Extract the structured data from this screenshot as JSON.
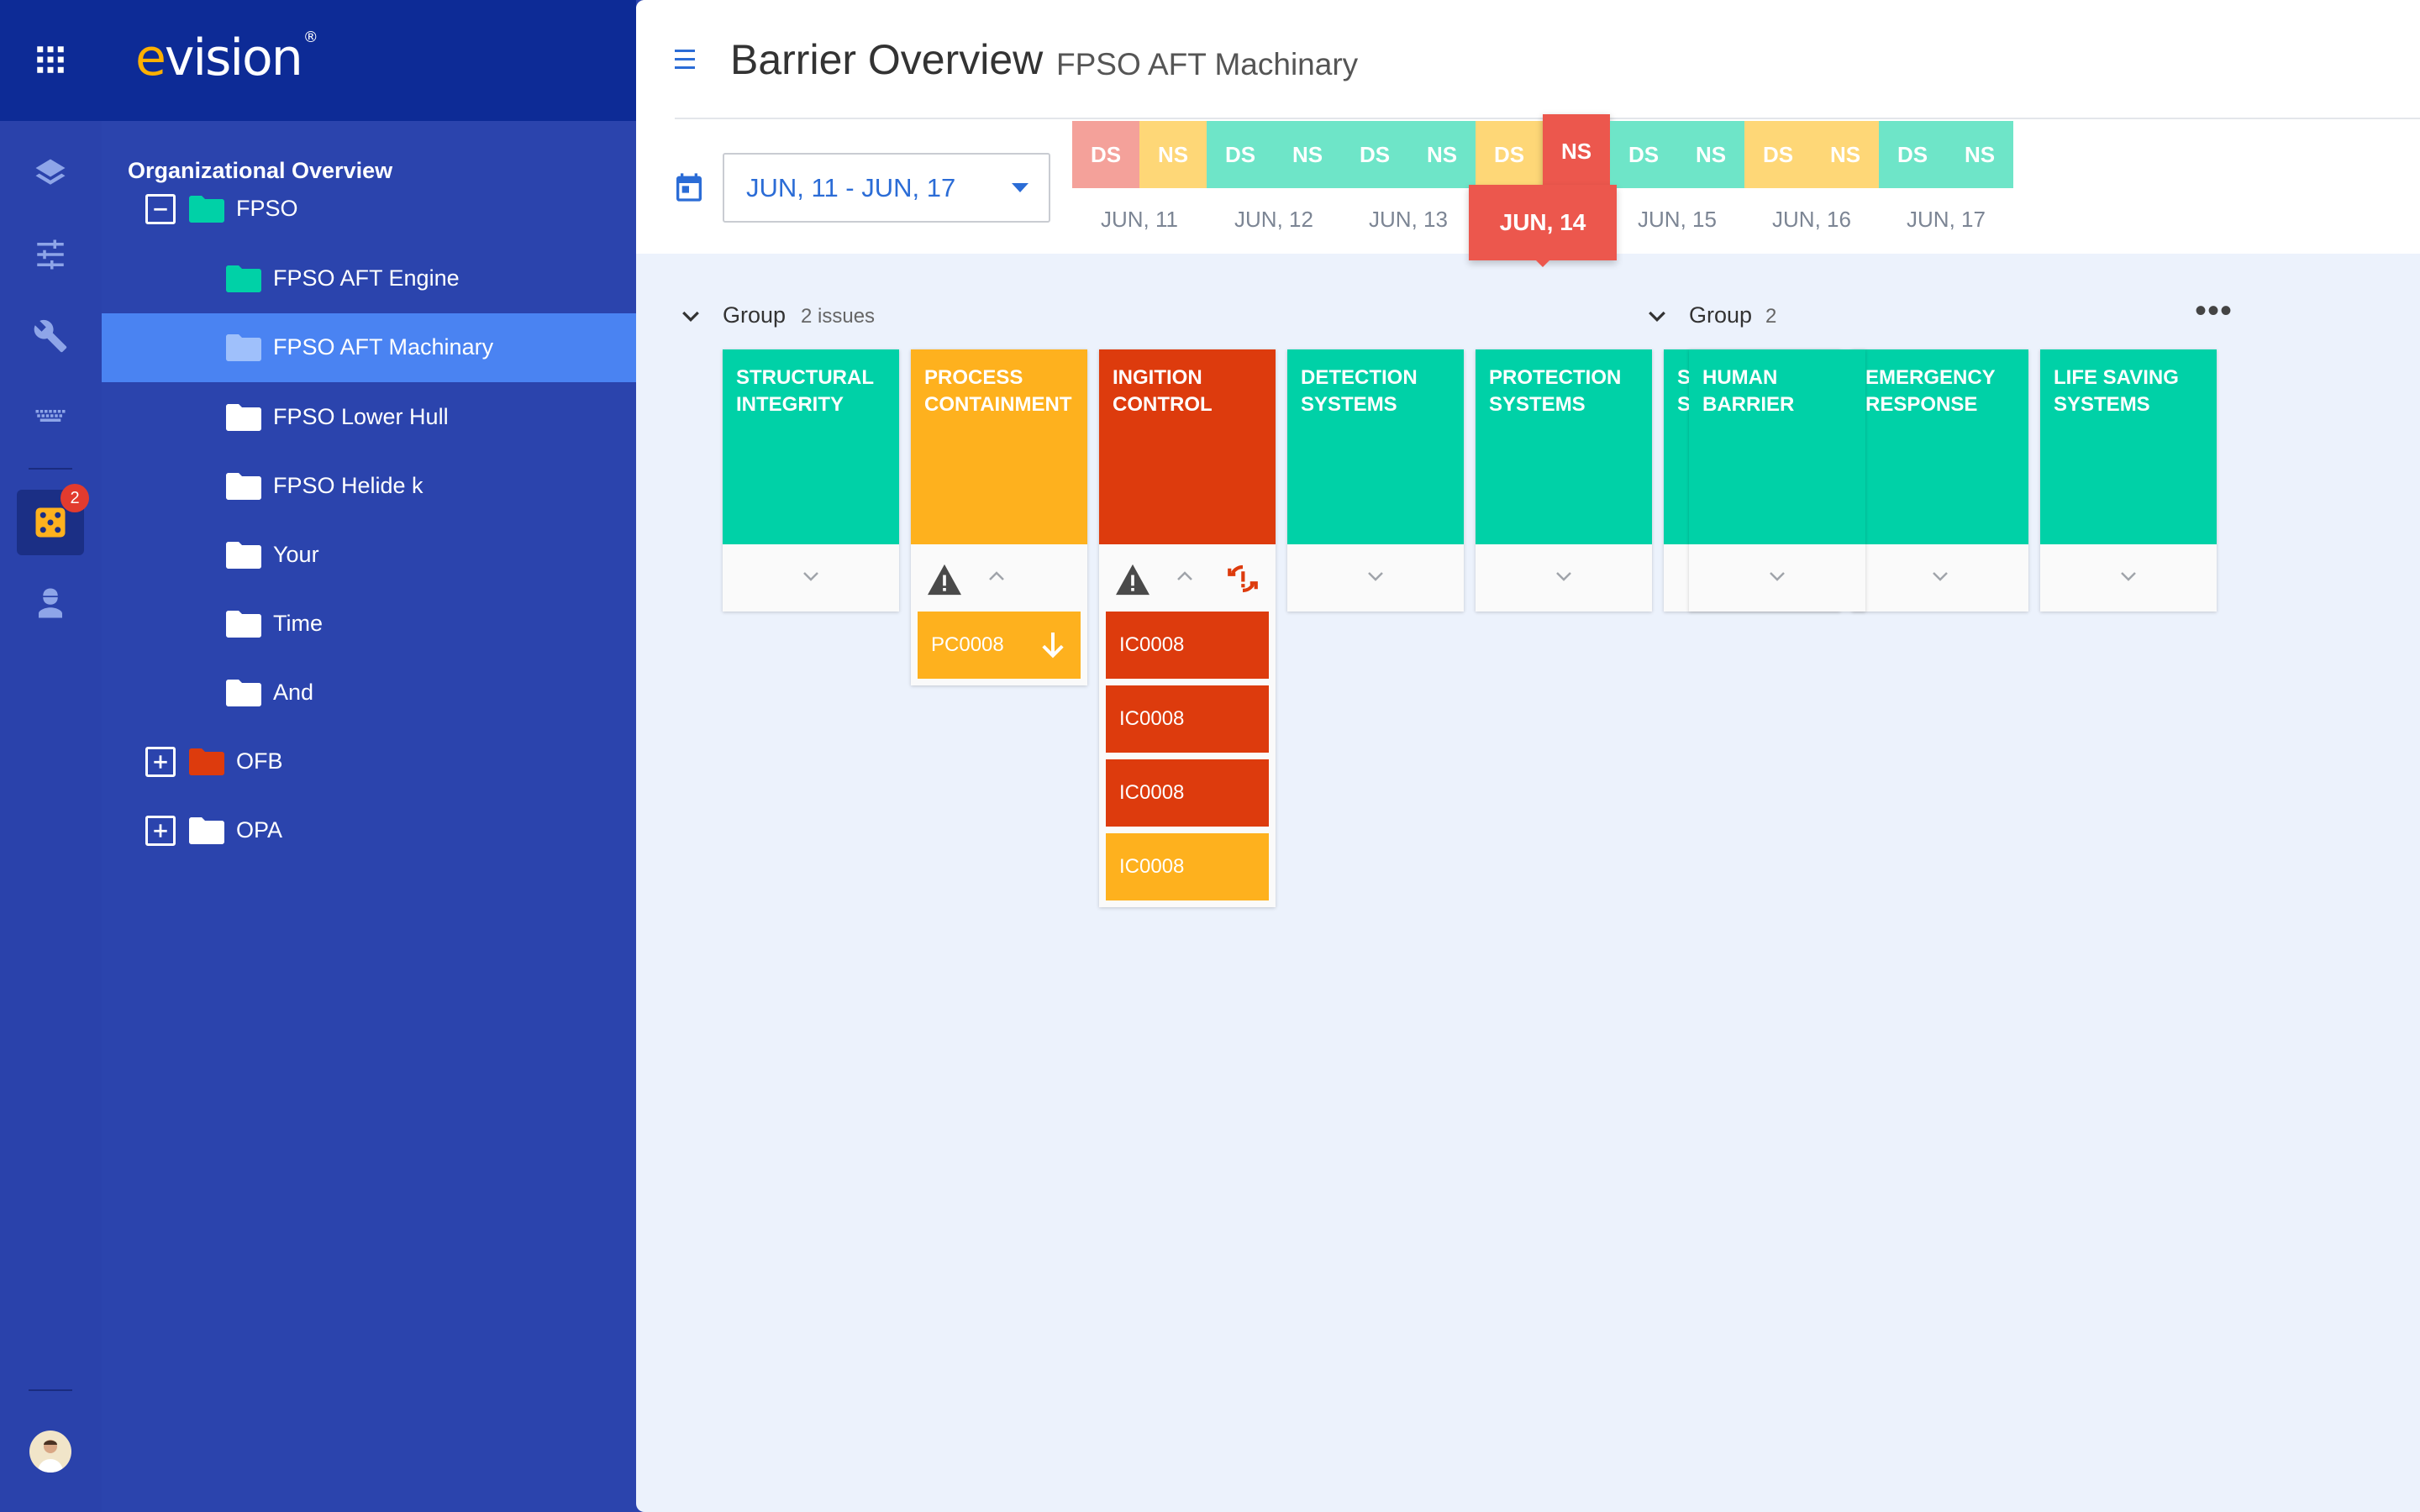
{
  "colors": {
    "green": "#00d1a7",
    "orange": "#feb11e",
    "red": "#dd3b0d",
    "shift_green": "#6ee5c8",
    "shift_yellow": "#fed777",
    "shift_pink": "#f4a19a",
    "shift_red": "#ec574d",
    "sidebar": "#2b44ad",
    "header": "#0d2b96",
    "selected": "#4a83f2"
  },
  "rail": {
    "icons": [
      "apps-grid-icon",
      "layers-icon",
      "sliders-icon",
      "wrench-icon",
      "keyboard-icon",
      "dice-icon",
      "worker-icon"
    ],
    "badge_count": "2"
  },
  "app": {
    "logo": "evision",
    "logo_mark": "®"
  },
  "tree": {
    "heading": "Organizational Overview",
    "items": [
      {
        "label": "FPSO",
        "toggle": "−",
        "folder_color": "#00d1a7"
      },
      {
        "label": "FPSO AFT Engine",
        "folder_color": "#00d1a7"
      },
      {
        "label": "FPSO AFT Machinary",
        "folder_color": "#9fc0fb",
        "selected": true
      },
      {
        "label": "FPSO Lower Hull",
        "folder_color": "#ffffff"
      },
      {
        "label": "FPSO Helide k",
        "folder_color": "#ffffff"
      },
      {
        "label": "Your",
        "folder_color": "#ffffff"
      },
      {
        "label": "Time",
        "folder_color": "#ffffff"
      },
      {
        "label": "And",
        "folder_color": "#ffffff"
      },
      {
        "label": "OFB",
        "toggle": "+",
        "folder_color": "#dd3b0d"
      },
      {
        "label": "OPA",
        "toggle": "+",
        "folder_color": "#ffffff"
      }
    ]
  },
  "header": {
    "title": "Barrier Overview",
    "subtitle": "FPSO AFT Machinary",
    "date_range": "JUN, 11 - JUN, 17"
  },
  "timeline": {
    "shifts": [
      {
        "label": "DS",
        "color": "shift_pink"
      },
      {
        "label": "NS",
        "color": "shift_yellow"
      },
      {
        "label": "DS",
        "color": "shift_green"
      },
      {
        "label": "NS",
        "color": "shift_green"
      },
      {
        "label": "DS",
        "color": "shift_green"
      },
      {
        "label": "NS",
        "color": "shift_green"
      },
      {
        "label": "DS",
        "color": "shift_yellow"
      },
      {
        "label": "NS",
        "color": "shift_red",
        "active": true
      },
      {
        "label": "DS",
        "color": "shift_green"
      },
      {
        "label": "NS",
        "color": "shift_green"
      },
      {
        "label": "DS",
        "color": "shift_yellow"
      },
      {
        "label": "NS",
        "color": "shift_yellow"
      },
      {
        "label": "DS",
        "color": "shift_green"
      },
      {
        "label": "NS",
        "color": "shift_green"
      }
    ],
    "days": [
      "JUN, 11",
      "JUN, 12",
      "JUN, 13",
      "JUN, 14",
      "JUN, 15",
      "JUN, 16",
      "JUN, 17"
    ],
    "active_day": "JUN, 14"
  },
  "groups": [
    {
      "title": "Group",
      "count": "2 issues",
      "barriers": [
        {
          "name": "STRUCTURAL INTEGRITY",
          "color": "green",
          "issues": []
        },
        {
          "name": "PROCESS CONTAINMENT",
          "color": "orange",
          "warning": true,
          "issues": [
            {
              "id": "PC0008",
              "color": "orange",
              "arrow": true
            }
          ]
        },
        {
          "name": "INGITION CONTROL",
          "color": "red",
          "warning": true,
          "sync": true,
          "issues": [
            {
              "id": "IC0008",
              "color": "red"
            },
            {
              "id": "IC0008",
              "color": "red"
            },
            {
              "id": "IC0008",
              "color": "red"
            },
            {
              "id": "IC0008",
              "color": "orange"
            }
          ]
        },
        {
          "name": "DETECTION SYSTEMS",
          "color": "green",
          "issues": []
        },
        {
          "name": "PROTECTION SYSTEMS",
          "color": "green",
          "issues": []
        },
        {
          "name": "SHUTDOWN SYSTEMS",
          "color": "green",
          "issues": []
        },
        {
          "name": "EMERGENCY RESPONSE",
          "color": "green",
          "issues": []
        },
        {
          "name": "LIFE SAVING SYSTEMS",
          "color": "green",
          "issues": []
        }
      ]
    },
    {
      "title": "Group",
      "count": "2",
      "barriers": [
        {
          "name": "HUMAN BARRIER",
          "color": "green",
          "issues": []
        }
      ]
    }
  ]
}
